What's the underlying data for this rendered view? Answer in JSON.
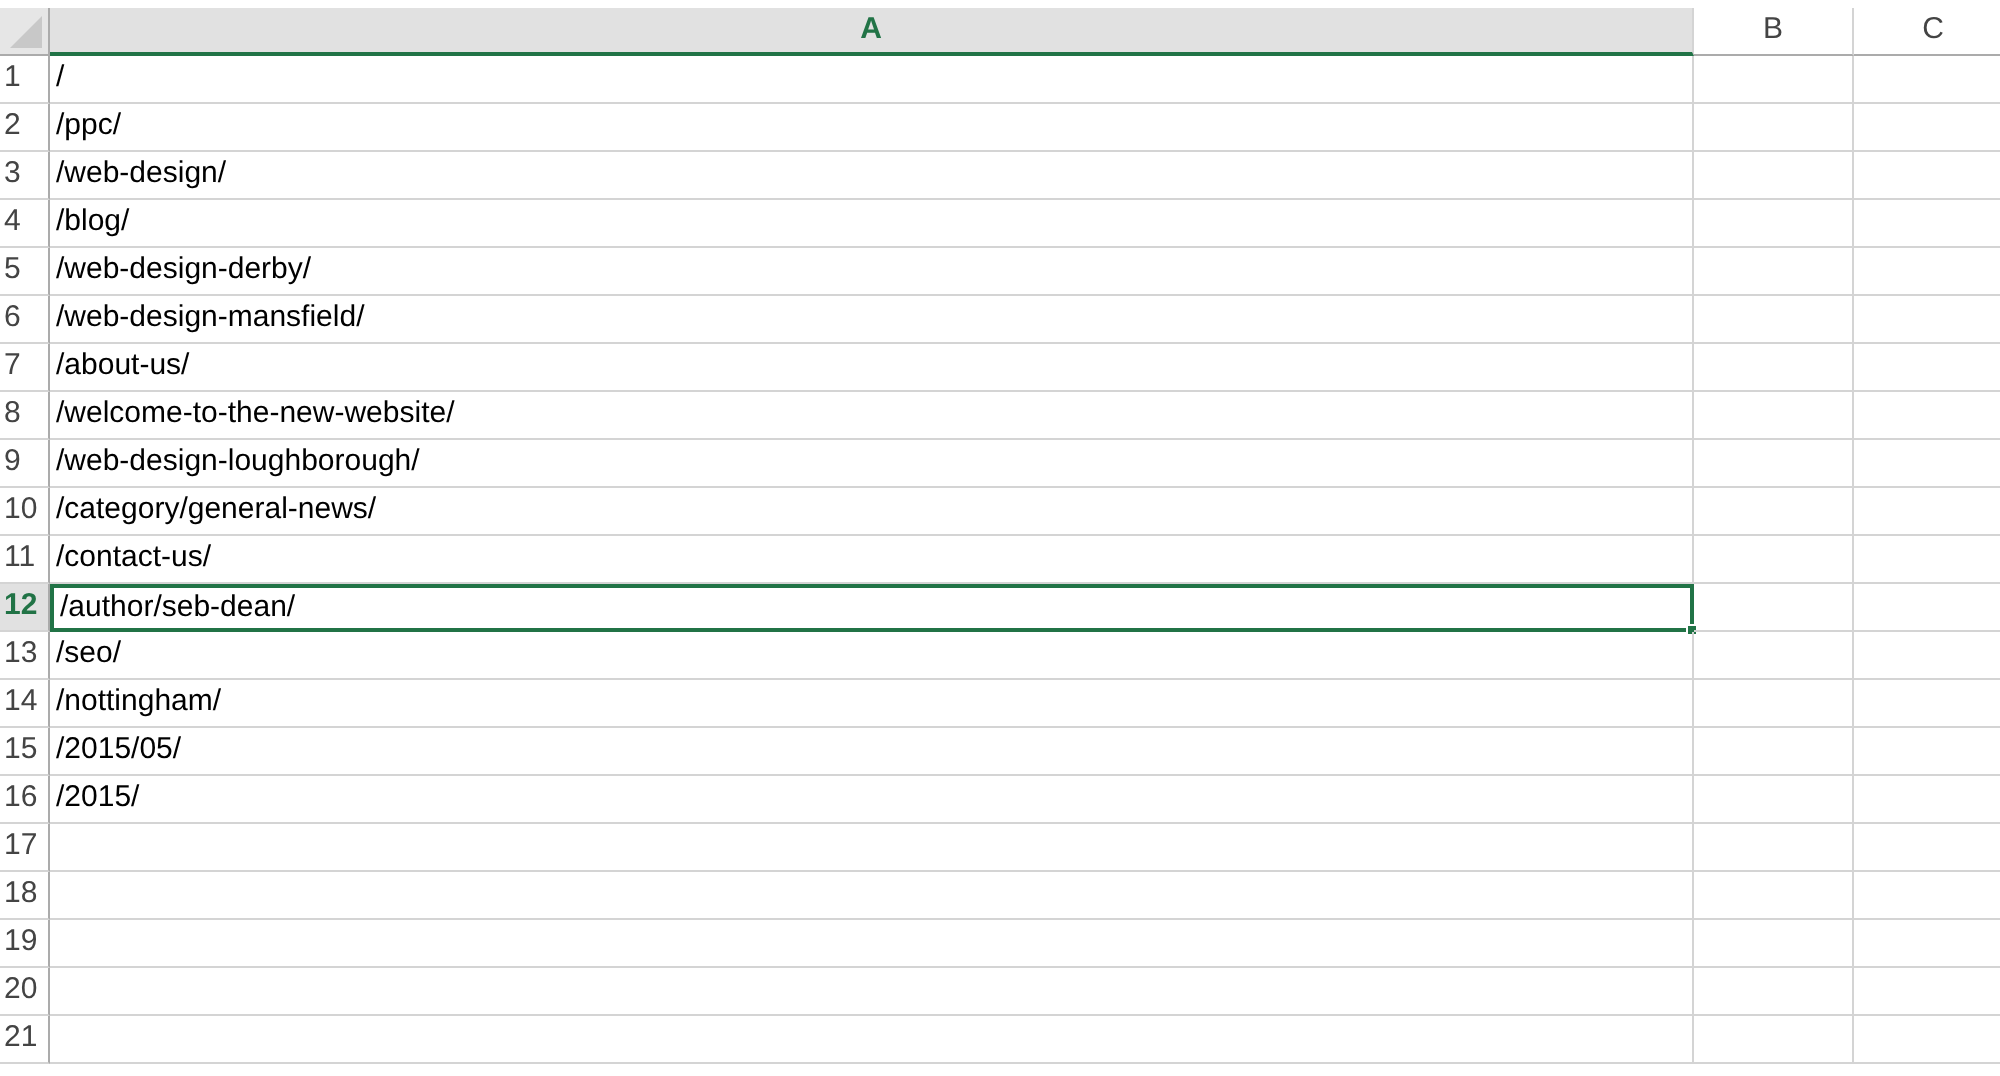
{
  "columns": [
    {
      "label": "A",
      "selected": true
    },
    {
      "label": "B",
      "selected": false
    },
    {
      "label": "C",
      "selected": false
    }
  ],
  "rows": [
    {
      "number": "1",
      "selected": false,
      "value": "/"
    },
    {
      "number": "2",
      "selected": false,
      "value": "/ppc/"
    },
    {
      "number": "3",
      "selected": false,
      "value": "/web-design/"
    },
    {
      "number": "4",
      "selected": false,
      "value": "/blog/"
    },
    {
      "number": "5",
      "selected": false,
      "value": "/web-design-derby/"
    },
    {
      "number": "6",
      "selected": false,
      "value": "/web-design-mansfield/"
    },
    {
      "number": "7",
      "selected": false,
      "value": "/about-us/"
    },
    {
      "number": "8",
      "selected": false,
      "value": "/welcome-to-the-new-website/"
    },
    {
      "number": "9",
      "selected": false,
      "value": "/web-design-loughborough/"
    },
    {
      "number": "10",
      "selected": false,
      "value": "/category/general-news/"
    },
    {
      "number": "11",
      "selected": false,
      "value": "/contact-us/"
    },
    {
      "number": "12",
      "selected": true,
      "value": "/author/seb-dean/"
    },
    {
      "number": "13",
      "selected": false,
      "value": "/seo/"
    },
    {
      "number": "14",
      "selected": false,
      "value": "/nottingham/"
    },
    {
      "number": "15",
      "selected": false,
      "value": "/2015/05/"
    },
    {
      "number": "16",
      "selected": false,
      "value": "/2015/"
    },
    {
      "number": "17",
      "selected": false
    },
    {
      "number": "18",
      "selected": false
    },
    {
      "number": "19",
      "selected": false
    },
    {
      "number": "20",
      "selected": false
    },
    {
      "number": "21",
      "selected": false
    }
  ]
}
